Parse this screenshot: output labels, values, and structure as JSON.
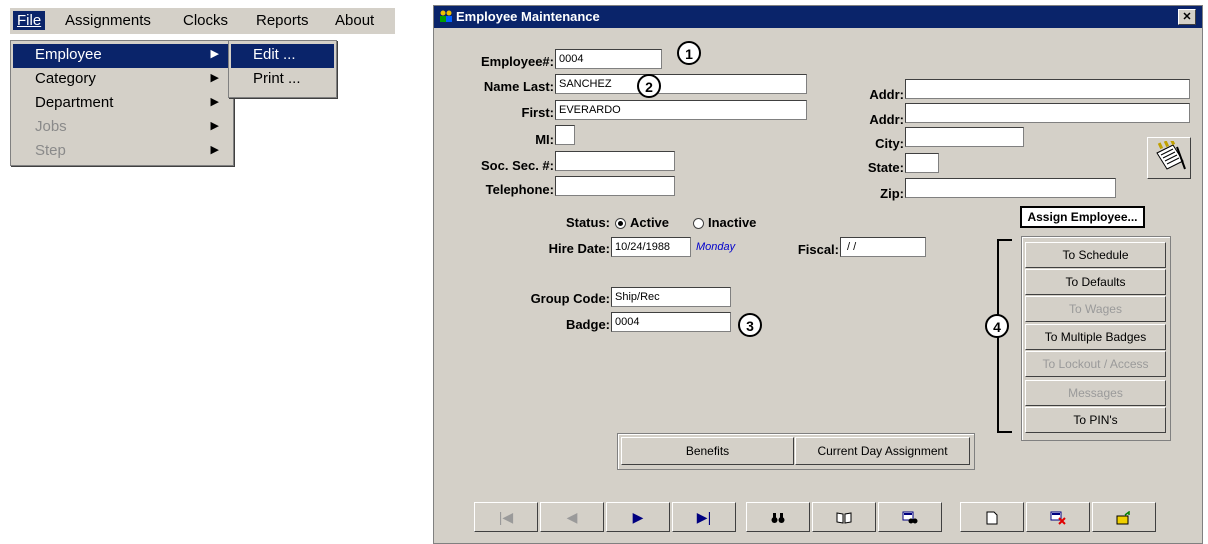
{
  "menubar": {
    "items": [
      "File",
      "Assignments",
      "Clocks",
      "Reports",
      "About"
    ]
  },
  "employee_menu": {
    "items": [
      {
        "label": "Employee",
        "state": "selected"
      },
      {
        "label": "Category",
        "state": "normal"
      },
      {
        "label": "Department",
        "state": "normal"
      },
      {
        "label": "Jobs",
        "state": "disabled"
      },
      {
        "label": "Step",
        "state": "disabled"
      }
    ]
  },
  "submenu": {
    "items": [
      "Edit ...",
      "Print ..."
    ]
  },
  "dialog": {
    "title": "Employee Maintenance",
    "close_glyph": "✕",
    "fields": {
      "employee_no": {
        "label": "Employee#:",
        "value": "0004"
      },
      "name_last": {
        "label": "Name Last:",
        "value": "SANCHEZ"
      },
      "first": {
        "label": "First:",
        "value": "EVERARDO"
      },
      "mi": {
        "label": "MI:",
        "value": ""
      },
      "ssn": {
        "label": "Soc. Sec. #:",
        "value": ""
      },
      "telephone": {
        "label": "Telephone:",
        "value": ""
      },
      "addr1": {
        "label": "Addr:",
        "value": ""
      },
      "addr2": {
        "label": "Addr:",
        "value": ""
      },
      "city": {
        "label": "City:",
        "value": ""
      },
      "state": {
        "label": "State:",
        "value": ""
      },
      "zip": {
        "label": "Zip:",
        "value": ""
      },
      "status": {
        "label": "Status:",
        "options": [
          "Active",
          "Inactive"
        ],
        "selected": "Active"
      },
      "hire_date": {
        "label": "Hire Date:",
        "value": "10/24/1988",
        "weekday": "Monday"
      },
      "fiscal": {
        "label": "Fiscal:",
        "value": " / /"
      },
      "group_code": {
        "label": "Group Code:",
        "value": "Ship/Rec"
      },
      "badge": {
        "label": "Badge:",
        "value": "0004"
      }
    },
    "callouts": [
      "1",
      "2",
      "3",
      "4"
    ],
    "assign_button": "Assign Employee...",
    "assign_buttons": [
      {
        "label": "To Schedule",
        "enabled": true
      },
      {
        "label": "To Defaults",
        "enabled": true
      },
      {
        "label": "To Wages",
        "enabled": false
      },
      {
        "label": "To Multiple Badges",
        "enabled": true
      },
      {
        "label": "To Lockout / Access",
        "enabled": false
      },
      {
        "label": "Messages",
        "enabled": false
      },
      {
        "label": "To PIN's",
        "enabled": true
      }
    ],
    "bottom_buttons": [
      "Benefits",
      "Current Day Assignment"
    ],
    "nav_icons": [
      "first-record-icon",
      "prev-record-icon",
      "next-record-icon",
      "last-record-icon",
      "find-icon",
      "book-icon",
      "search-record-icon",
      "new-record-icon",
      "delete-record-icon",
      "save-record-icon"
    ],
    "colors": {
      "titlebar": "#0a246a",
      "face": "#d4d0c8",
      "weekday": "#0000cc"
    }
  }
}
